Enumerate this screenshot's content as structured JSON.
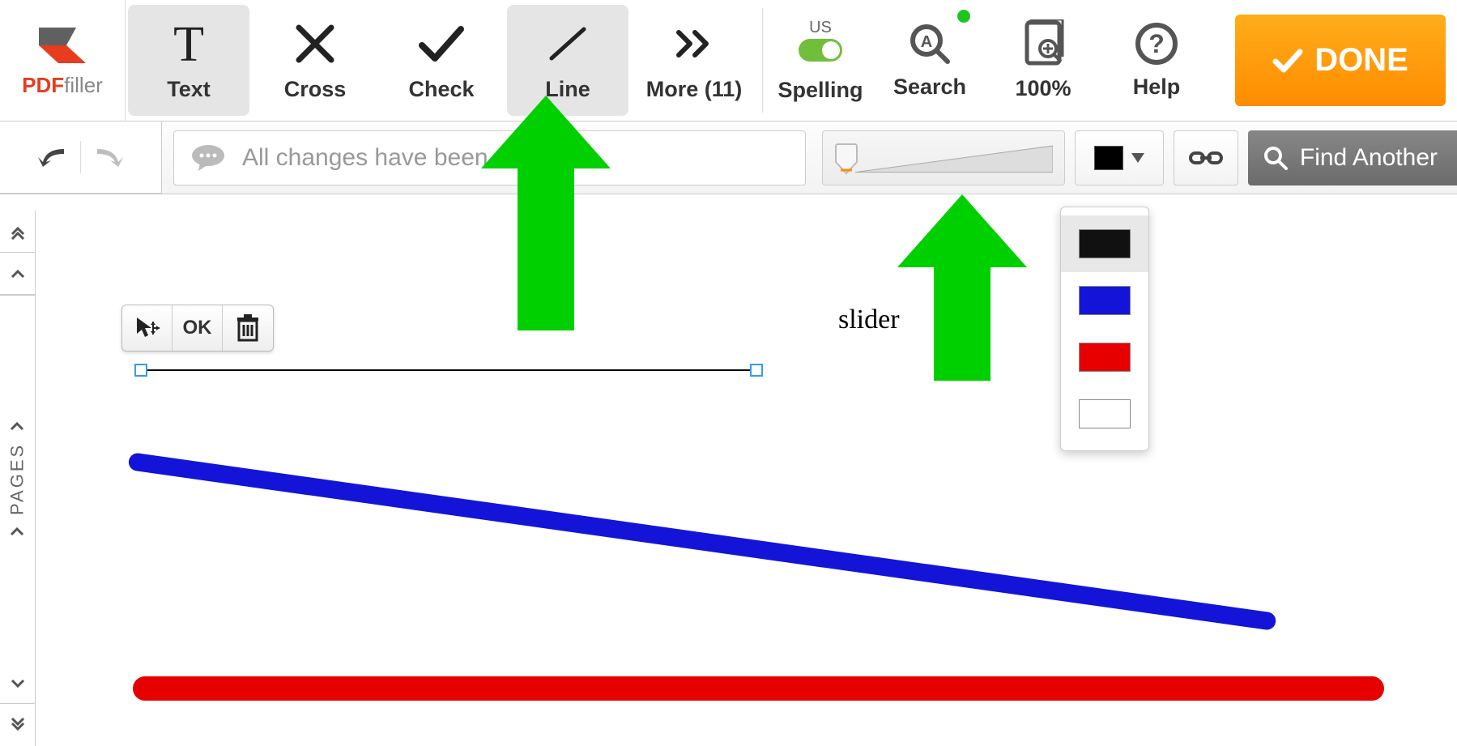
{
  "brand": {
    "name_bold": "PDF",
    "name_rest": "filler"
  },
  "toolbar": {
    "text": "Text",
    "cross": "Cross",
    "check": "Check",
    "line": "Line",
    "more": "More (11)",
    "spelling": {
      "locale": "US",
      "label": "Spelling"
    },
    "search": "Search",
    "zoom": "100%",
    "help": "Help",
    "done": "DONE"
  },
  "second_bar": {
    "status": "All changes have been sa",
    "find_another": "Find Another"
  },
  "pages_strip": {
    "label": "PAGES"
  },
  "line_toolbar": {
    "ok": "OK"
  },
  "annotations": {
    "slider": "slider"
  },
  "colors": {
    "black": "#111111",
    "blue": "#1414d8",
    "red": "#e60000",
    "white": "#ffffff"
  }
}
